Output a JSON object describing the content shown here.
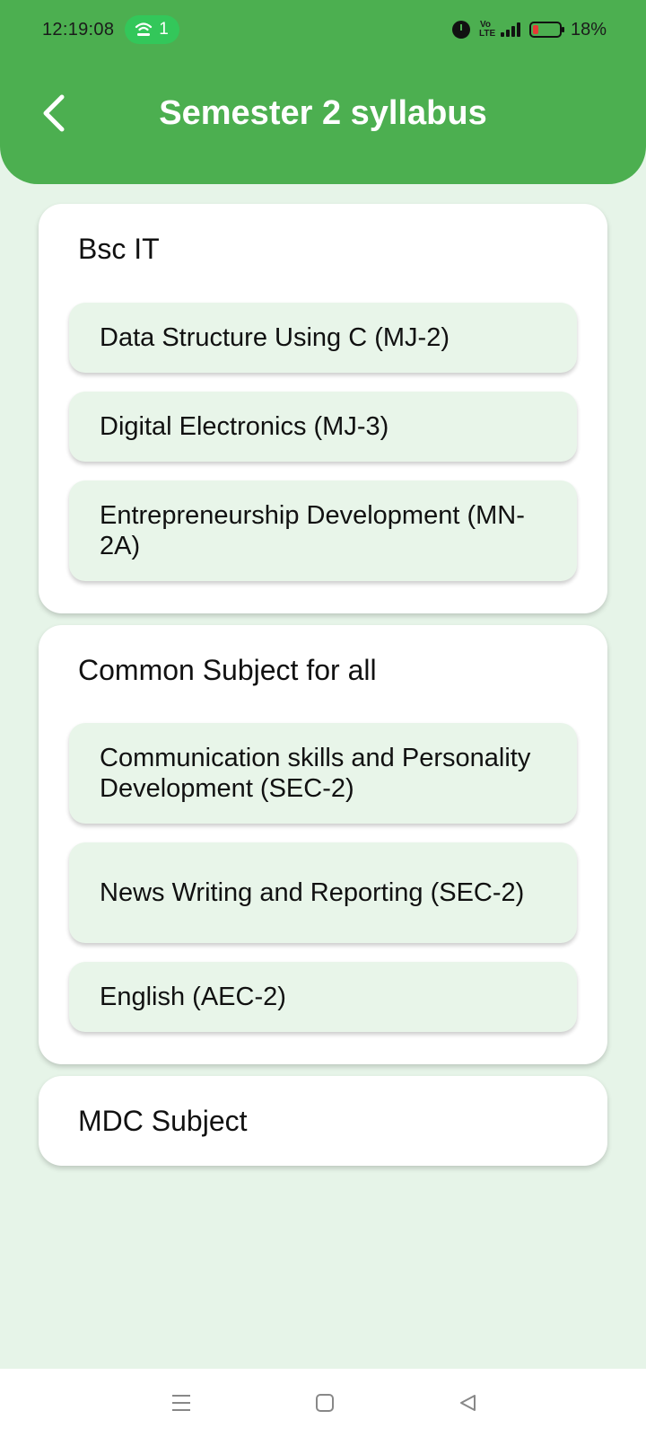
{
  "status": {
    "time": "12:19:08",
    "hotspot_count": "1",
    "network_label": "Vo LTE",
    "battery": "18%"
  },
  "appbar": {
    "title": "Semester 2 syllabus"
  },
  "sections": [
    {
      "title": "Bsc IT",
      "items": [
        "Data Structure Using C (MJ-2)",
        "Digital Electronics (MJ-3)",
        "Entrepreneurship Development (MN-2A)"
      ]
    },
    {
      "title": "Common Subject for all",
      "items": [
        "Communication skills and Personality Development (SEC-2)",
        "News Writing and Reporting (SEC-2)",
        "English (AEC-2)"
      ]
    },
    {
      "title": "MDC Subject",
      "items": []
    }
  ],
  "colors": {
    "primary": "#4caf50",
    "background": "#e6f4e8",
    "item_background": "#e8f5e9"
  },
  "icons": {
    "back": "back-arrow-icon",
    "menu": "menu-icon",
    "home": "home-icon",
    "nav_back": "nav-back-icon"
  }
}
